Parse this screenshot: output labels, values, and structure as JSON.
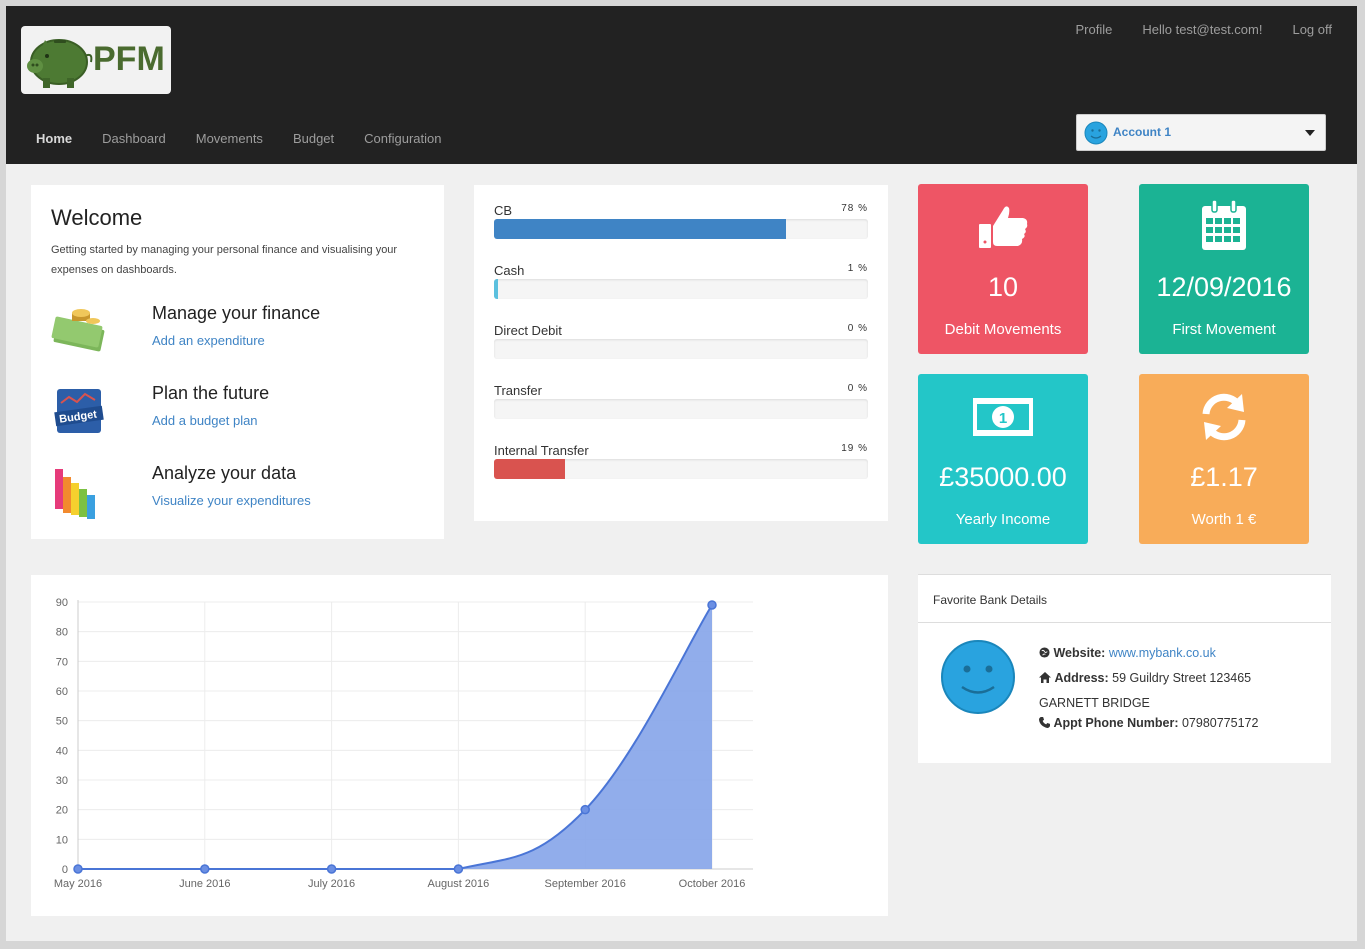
{
  "brand": {
    "logo_text": "PFM"
  },
  "topnav": {
    "profile": "Profile",
    "greeting": "Hello test@test.com!",
    "logoff": "Log off"
  },
  "mainnav": {
    "items": [
      "Home",
      "Dashboard",
      "Movements",
      "Budget",
      "Configuration"
    ],
    "active": "Home"
  },
  "account": {
    "label": "Account 1"
  },
  "welcome": {
    "title": "Welcome",
    "intro": "Getting started by managing your personal finance and visualising your expenses on dashboards.",
    "features": [
      {
        "title": "Manage your finance",
        "link": "Add an expenditure",
        "icon": "money-icon"
      },
      {
        "title": "Plan the future",
        "link": "Add a budget plan",
        "icon": "budget-icon"
      },
      {
        "title": "Analyze your data",
        "link": "Visualize your expenditures",
        "icon": "bar-chart-icon"
      }
    ]
  },
  "progress": [
    {
      "label": "CB",
      "percent_text": "78 %",
      "percent": 78,
      "color": "#3f84c5"
    },
    {
      "label": "Cash",
      "percent_text": "1 %",
      "percent": 1,
      "color": "#5bc0de"
    },
    {
      "label": "Direct Debit",
      "percent_text": "0 %",
      "percent": 0,
      "color": "#5cb85c"
    },
    {
      "label": "Transfer",
      "percent_text": "0 %",
      "percent": 0,
      "color": "#f0ad4e"
    },
    {
      "label": "Internal Transfer",
      "percent_text": "19 %",
      "percent": 19,
      "color": "#d9534f"
    }
  ],
  "tiles": [
    {
      "value": "10",
      "label": "Debit Movements",
      "color": "#ee5565",
      "icon": "thumbs-up-icon"
    },
    {
      "value": "12/09/2016",
      "label": "First Movement",
      "color": "#1bb394",
      "icon": "calendar-icon"
    },
    {
      "value": "£35000.00",
      "label": "Yearly Income",
      "color": "#23c6c8",
      "icon": "money-bill-icon"
    },
    {
      "value": "£1.17",
      "label": "Worth 1 €",
      "color": "#f8ac59",
      "icon": "refresh-icon"
    }
  ],
  "chart_data": {
    "type": "area",
    "categories": [
      "May 2016",
      "June 2016",
      "July 2016",
      "August 2016",
      "September 2016",
      "October 2016"
    ],
    "values": [
      0,
      0,
      0,
      0,
      20,
      89
    ],
    "ylim": [
      0,
      90
    ],
    "yticks": [
      "0",
      "10",
      "20",
      "30",
      "40",
      "50",
      "60",
      "70",
      "80",
      "90"
    ],
    "grid": true,
    "fill_color": "#8ba9ea",
    "line_color": "#4a75d6"
  },
  "bank": {
    "header": "Favorite Bank Details",
    "website_label": "Website:",
    "website": "www.mybank.co.uk",
    "address_label": "Address:",
    "address_line1": "59 Guildry Street 123465",
    "address_line2": "GARNETT BRIDGE",
    "phone_label": "Appt Phone Number:",
    "phone": "07980775172"
  }
}
